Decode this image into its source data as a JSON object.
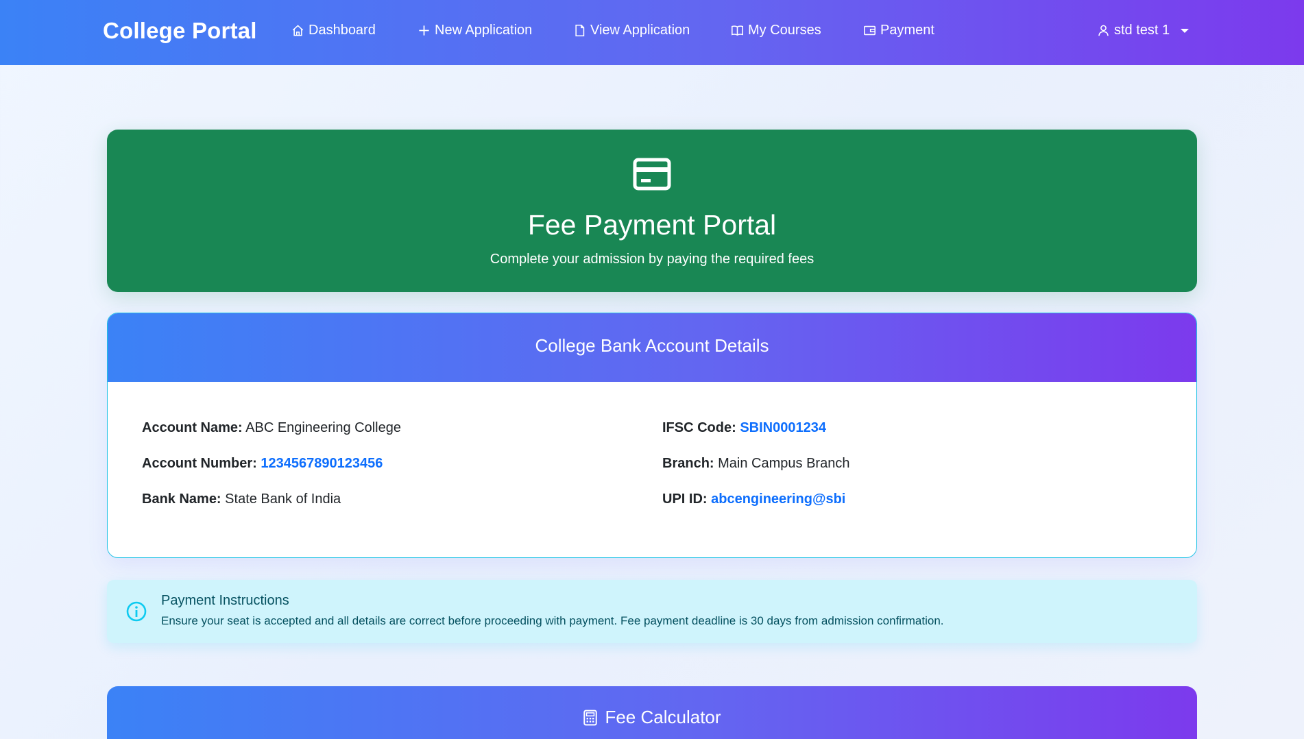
{
  "navbar": {
    "brand": "College Portal",
    "items": [
      {
        "label": "Dashboard",
        "icon": "home-icon"
      },
      {
        "label": "New Application",
        "icon": "plus-icon"
      },
      {
        "label": "View Application",
        "icon": "file-icon"
      },
      {
        "label": "My Courses",
        "icon": "book-icon"
      },
      {
        "label": "Payment",
        "icon": "wallet-icon"
      }
    ],
    "user": {
      "label": "std test 1",
      "icon": "user-icon"
    }
  },
  "hero": {
    "icon": "credit-card-icon",
    "title": "Fee Payment Portal",
    "subtitle": "Complete your admission by paying the required fees"
  },
  "bank": {
    "title": "College Bank Account Details",
    "account_name": {
      "label": "Account Name:",
      "value": "ABC Engineering College"
    },
    "account_number": {
      "label": "Account Number:",
      "value": "1234567890123456"
    },
    "bank_name": {
      "label": "Bank Name:",
      "value": "State Bank of India"
    },
    "ifsc": {
      "label": "IFSC Code:",
      "value": "SBIN0001234"
    },
    "branch": {
      "label": "Branch:",
      "value": "Main Campus Branch"
    },
    "upi": {
      "label": "UPI ID:",
      "value": "abcengineering@sbi"
    }
  },
  "alert": {
    "icon": "info-icon",
    "title": "Payment Instructions",
    "text": "Ensure your seat is accepted and all details are correct before proceeding with payment. Fee payment deadline is 30 days from admission confirmation."
  },
  "calculator": {
    "icon": "calculator-icon",
    "title": "Fee Calculator"
  },
  "colors": {
    "nav_gradient_start": "#3b82f6",
    "nav_gradient_end": "#7c3aed",
    "hero_green": "#198754",
    "link_blue": "#0d6efd",
    "alert_bg": "#cff4fc",
    "alert_text": "#055160"
  }
}
